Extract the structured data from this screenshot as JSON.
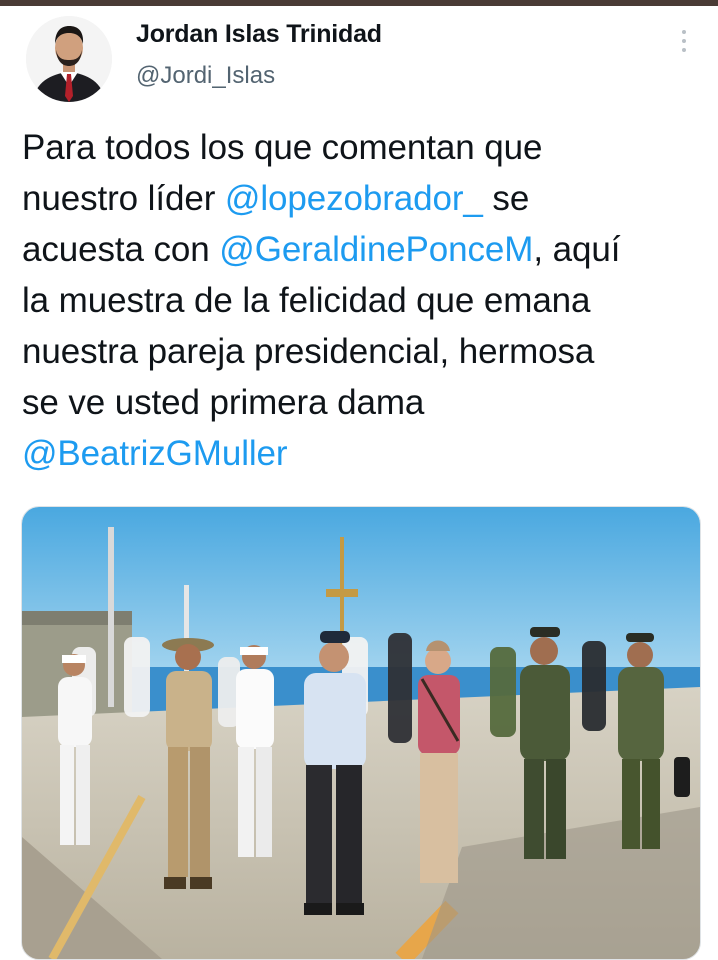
{
  "author": {
    "display_name": "Jordan Islas Trinidad",
    "handle": "@Jordi_Islas"
  },
  "tweet": {
    "lines": [
      [
        {
          "text": "Para todos los que comentan que",
          "type": "text"
        }
      ],
      [
        {
          "text": "nuestro líder ",
          "type": "text"
        },
        {
          "text": "@lopezobrador_",
          "type": "mention"
        },
        {
          "text": " se",
          "type": "text"
        }
      ],
      [
        {
          "text": "acuesta con ",
          "type": "text"
        },
        {
          "text": "@GeraldinePonceM",
          "type": "mention"
        },
        {
          "text": ", aquí",
          "type": "text"
        }
      ],
      [
        {
          "text": "la muestra de la felicidad que emana",
          "type": "text"
        }
      ],
      [
        {
          "text": "nuestra pareja presidencial, hermosa",
          "type": "text"
        }
      ],
      [
        {
          "text": "se ve usted primera dama",
          "type": "text"
        }
      ],
      [
        {
          "text": "@BeatrizGMuller",
          "type": "mention"
        }
      ]
    ],
    "mentions": [
      "@lopezobrador_",
      "@GeraldinePonceM",
      "@BeatrizGMuller"
    ]
  },
  "icons": {
    "more": "more-vertical-icon",
    "avatar": "user-avatar"
  },
  "colors": {
    "text": "#0f1419",
    "secondary": "#536471",
    "mention": "#1d9bf0",
    "top_strip": "#4a3b35"
  }
}
